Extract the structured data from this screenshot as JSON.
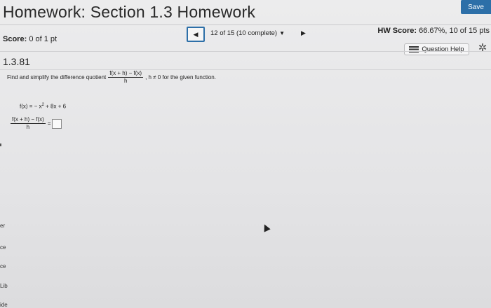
{
  "header": {
    "title": "Homework: Section 1.3 Homework",
    "save_label": "Save"
  },
  "score": {
    "label": "Score:",
    "value": "0 of 1 pt"
  },
  "navigation": {
    "progress_text": "12 of 15 (10 complete)",
    "prev_icon": "◀",
    "next_icon": "▶",
    "dropdown_icon": "▼"
  },
  "hw_score": {
    "label": "HW Score:",
    "value": "66.67%, 10 of 15 pts"
  },
  "question": {
    "number": "1.3.81",
    "help_label": "Question Help",
    "instruction_prefix": "Find and simplify the difference quotient",
    "quotient_numerator": "f(x + h) − f(x)",
    "quotient_denominator": "h",
    "instruction_suffix": ", h ≠ 0 for the given function.",
    "function_text": "f(x) = − x",
    "function_exponent": "2",
    "function_rest": " + 8x + 6",
    "answer_equals": "="
  },
  "left_edge_fragments": [
    "er",
    "ce",
    "ce",
    "Lib",
    "ide"
  ]
}
